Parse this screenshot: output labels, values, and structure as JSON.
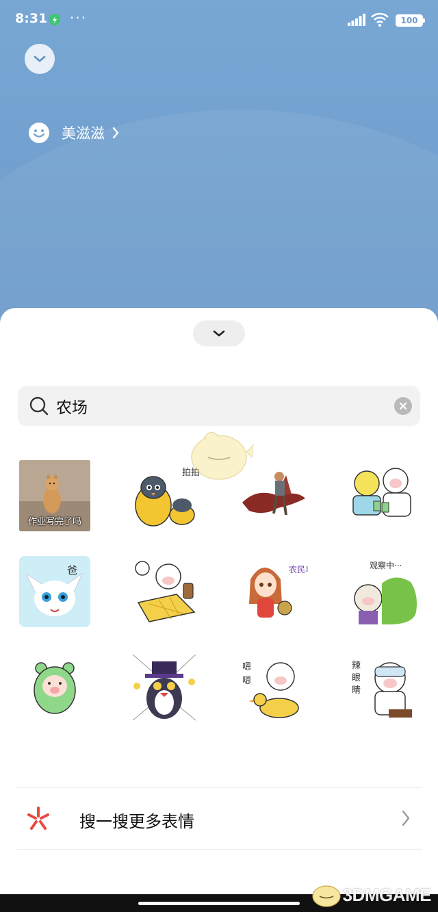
{
  "status_bar": {
    "time": "8:31",
    "dots": "···",
    "battery": "100"
  },
  "header": {
    "avatar_name": "美滋滋"
  },
  "search": {
    "query": "农场",
    "placeholder": "农场"
  },
  "stickers": [
    {
      "icon": "cat-photo-sticker",
      "caption": "作业写完了吗"
    },
    {
      "icon": "penguin-sticker",
      "caption": "拍拍"
    },
    {
      "icon": "dragon-rider-sticker",
      "caption": ""
    },
    {
      "icon": "pig-cards-sticker",
      "caption": ""
    },
    {
      "icon": "white-fox-sticker",
      "caption": "爸"
    },
    {
      "icon": "pig-bed-sticker",
      "caption": ""
    },
    {
      "icon": "girl-drum-sticker",
      "caption": "农民丰收啦"
    },
    {
      "icon": "pig-bush-sticker",
      "caption": "观察中···"
    },
    {
      "icon": "green-pig-sticker",
      "caption": ""
    },
    {
      "icon": "penguin-hat-sticker",
      "caption": ""
    },
    {
      "icon": "pig-duck-sticker",
      "caption": "嗯嗯"
    },
    {
      "icon": "pig-goggles-sticker",
      "caption": "辣眼睛"
    }
  ],
  "more": {
    "label": "搜一搜更多表情"
  },
  "watermark": {
    "text": "3DMGAME"
  },
  "colors": {
    "background": "#6f9bc9",
    "sheet": "#ffffff",
    "search_bg": "#f2f2f2",
    "accent_red": "#e8493e"
  }
}
